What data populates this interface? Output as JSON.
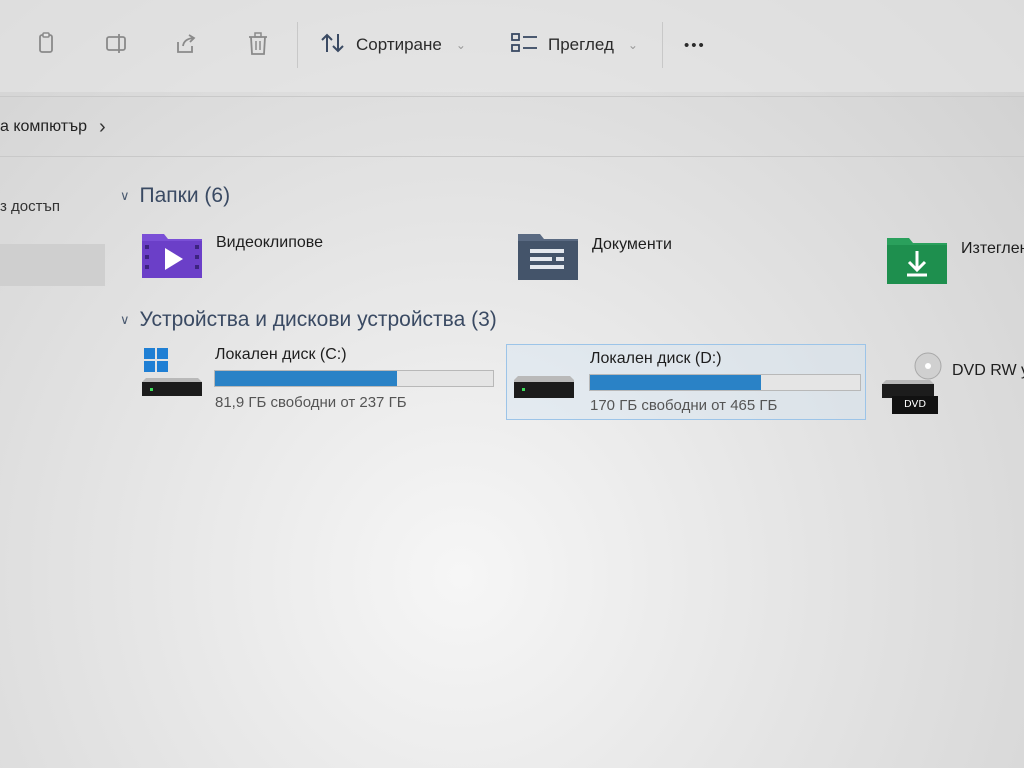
{
  "toolbar": {
    "sort_label": "Сортиране",
    "view_label": "Преглед",
    "more_label": "•••"
  },
  "address": {
    "path_label": "а компютър",
    "separator": "›"
  },
  "nav": {
    "quick_access_label": "з достъп"
  },
  "folders_section": {
    "title": "Папки (6)",
    "items": [
      {
        "label": "Видеоклипове",
        "icon": "videos-folder-icon",
        "color": "#6b3fc8"
      },
      {
        "label": "Документи",
        "icon": "documents-folder-icon",
        "color": "#44546a"
      },
      {
        "label": "Изтеглен",
        "icon": "downloads-folder-icon",
        "color": "#1e8f4e"
      }
    ]
  },
  "drives_section": {
    "title": "Устройства и дискови устройства (3)",
    "drives": [
      {
        "name": "Локален диск (C:)",
        "info": "81,9 ГБ свободни от 237 ГБ",
        "used_fraction": 0.655
      },
      {
        "name": "Локален диск (D:)",
        "info": "170 ГБ свободни от 465 ГБ",
        "used_fraction": 0.634
      },
      {
        "name": "DVD RW у",
        "badge": "DVD"
      }
    ]
  },
  "colors": {
    "bar_fill": "#2a82c6",
    "section_title": "#3a4a63",
    "selection_border": "#9cc4e8"
  }
}
